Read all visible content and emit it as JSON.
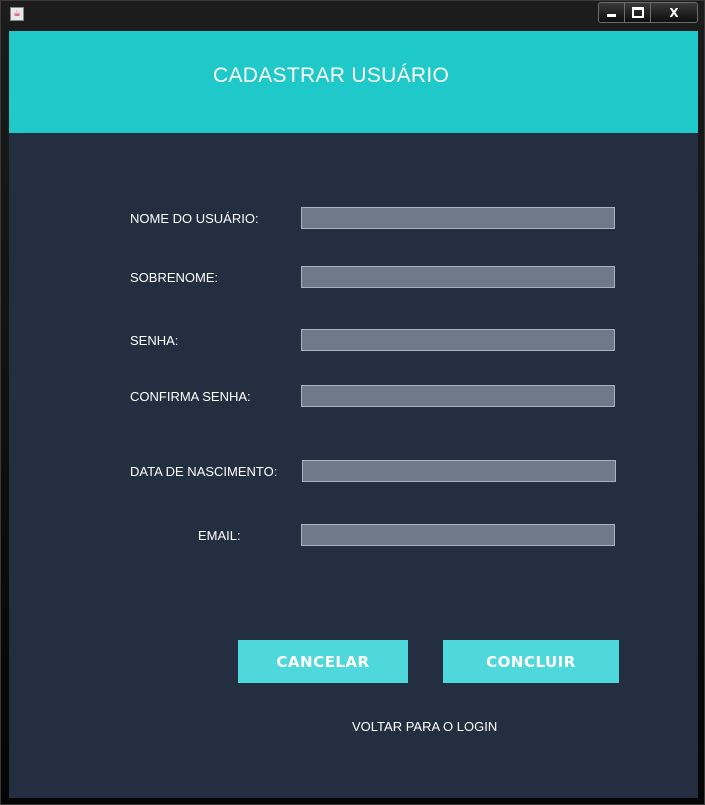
{
  "window": {
    "app_icon": "java-icon",
    "controls": {
      "minimize": "minimize-icon",
      "maximize": "maximize-icon",
      "close_label": "X"
    }
  },
  "header": {
    "title": "CADASTRAR USUÁRIO"
  },
  "form": {
    "fields": [
      {
        "label": "NOME DO USUÁRIO:",
        "value": ""
      },
      {
        "label": "SOBRENOME:",
        "value": ""
      },
      {
        "label": "SENHA:",
        "value": ""
      },
      {
        "label": "CONFIRMA SENHA:",
        "value": ""
      },
      {
        "label": "DATA DE NASCIMENTO:",
        "value": ""
      },
      {
        "label": "EMAIL:",
        "value": ""
      }
    ]
  },
  "actions": {
    "cancel_label": "CANCELAR",
    "submit_label": "CONCLUIR",
    "back_link": "VOLTAR PARA O LOGIN"
  },
  "colors": {
    "header_bg": "#1fc8c9",
    "panel_bg": "#232f41",
    "input_bg": "#6e7a89",
    "button_bg": "#4fd8dc"
  }
}
